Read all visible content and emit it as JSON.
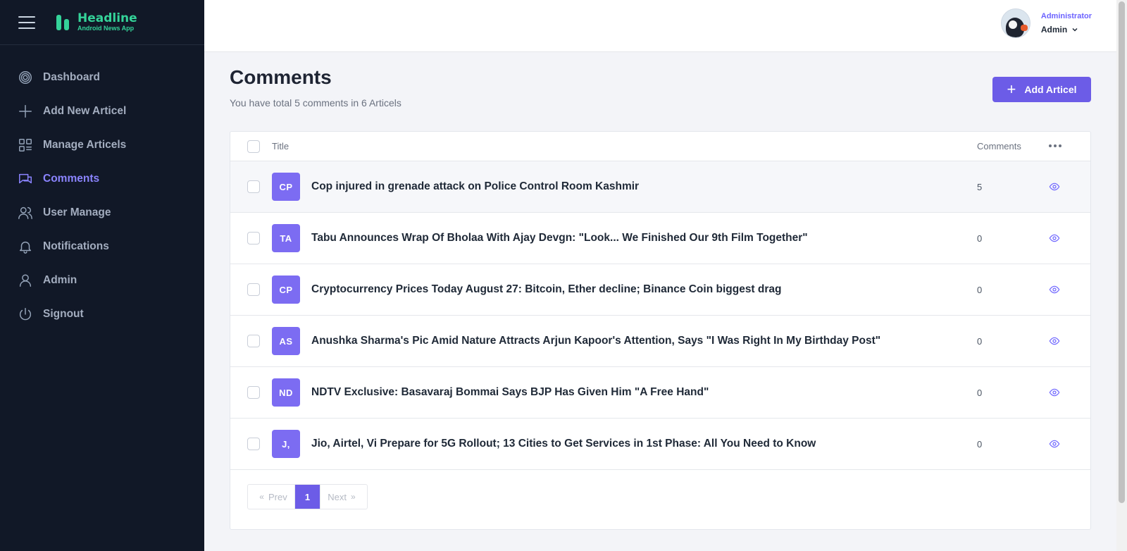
{
  "app": {
    "title": "Headline",
    "subtitle": "Android News App"
  },
  "sidebar": {
    "items": [
      {
        "label": "Dashboard",
        "icon": "dashboard-icon"
      },
      {
        "label": "Add New Articel",
        "icon": "plus-icon"
      },
      {
        "label": "Manage Articels",
        "icon": "grid-icon"
      },
      {
        "label": "Comments",
        "icon": "comments-icon",
        "active": true
      },
      {
        "label": "User Manage",
        "icon": "users-icon"
      },
      {
        "label": "Notifications",
        "icon": "bell-icon"
      },
      {
        "label": "Admin",
        "icon": "user-icon"
      },
      {
        "label": "Signout",
        "icon": "power-icon"
      }
    ]
  },
  "user": {
    "role": "Administrator",
    "name": "Admin"
  },
  "page": {
    "title": "Comments",
    "subtitle": "You have total 5 comments in 6 Articels",
    "add_button": "Add Articel"
  },
  "table": {
    "headers": {
      "title": "Title",
      "comments": "Comments"
    },
    "rows": [
      {
        "initials": "CP",
        "title": "Cop injured in grenade attack on Police Control Room Kashmir",
        "comments": "5"
      },
      {
        "initials": "TA",
        "title": "Tabu Announces Wrap Of Bholaa With Ajay Devgn: \"Look... We Finished Our 9th Film Together\"",
        "comments": "0"
      },
      {
        "initials": "CP",
        "title": "Cryptocurrency Prices Today August 27: Bitcoin, Ether decline; Binance Coin biggest drag",
        "comments": "0"
      },
      {
        "initials": "AS",
        "title": "Anushka Sharma's Pic Amid Nature Attracts Arjun Kapoor's Attention, Says \"I Was Right In My Birthday Post\"",
        "comments": "0"
      },
      {
        "initials": "ND",
        "title": "NDTV Exclusive: Basavaraj Bommai Says BJP Has Given Him \"A Free Hand\"",
        "comments": "0"
      },
      {
        "initials": "J,",
        "title": "Jio, Airtel, Vi Prepare for 5G Rollout; 13 Cities to Get Services in 1st Phase: All You Need to Know",
        "comments": "0"
      }
    ]
  },
  "pagination": {
    "prev": "Prev",
    "current": "1",
    "next": "Next"
  },
  "colors": {
    "sidebar_bg": "#111827",
    "accent": "#6c5ce7",
    "brand": "#34d399"
  }
}
